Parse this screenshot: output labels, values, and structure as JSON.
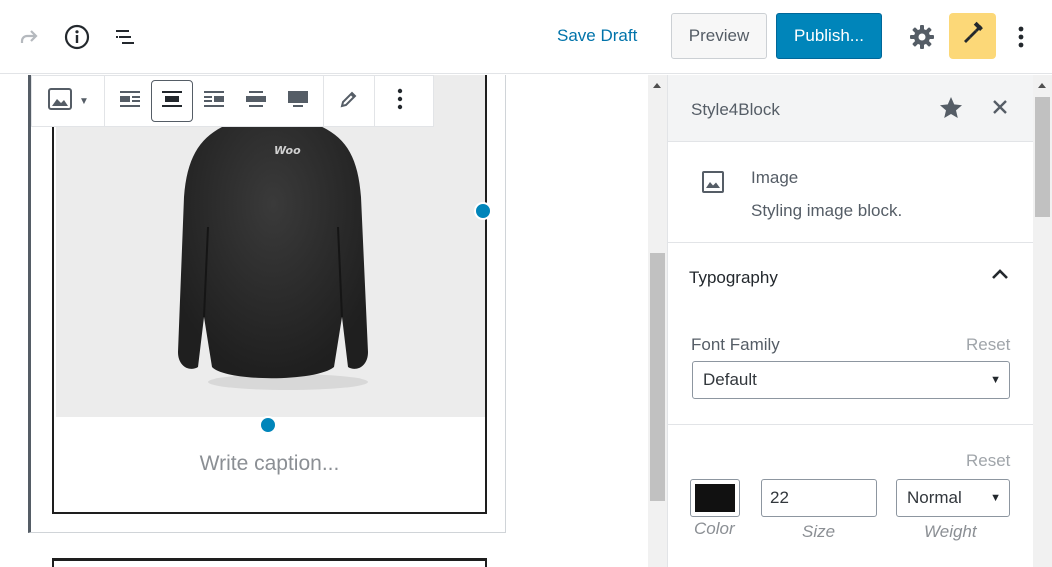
{
  "topbar": {
    "redo_icon": "redo-icon",
    "info_icon": "info-icon",
    "outline_icon": "block-navigation-icon",
    "save_draft": "Save Draft",
    "preview": "Preview",
    "publish": "Publish...",
    "settings_icon": "gear-icon",
    "brush_icon": "paint-brush-icon",
    "more_icon": "more-vertical-icon"
  },
  "block_toolbar": {
    "block_type_icon": "image-icon",
    "align_options": [
      "align-left",
      "align-center",
      "align-right",
      "wide-width",
      "full-width"
    ],
    "active_align": "align-center",
    "edit_icon": "pencil-icon",
    "more_icon": "more-vertical-icon"
  },
  "editor": {
    "image_logo_text": "Woo",
    "caption_placeholder": "Write caption..."
  },
  "sidebar": {
    "title": "Style4Block",
    "block": {
      "name": "Image",
      "description": "Styling image block."
    },
    "typography": {
      "title": "Typography",
      "font_family_label": "Font Family",
      "font_family_reset": "Reset",
      "font_family_value": "Default",
      "style_reset": "Reset",
      "color_label": "Color",
      "color_value": "#111111",
      "size_label": "Size",
      "size_value": "22",
      "weight_label": "Weight",
      "weight_value": "Normal"
    }
  },
  "colors": {
    "accent": "#0085ba",
    "brush_bg": "#fcd878"
  }
}
